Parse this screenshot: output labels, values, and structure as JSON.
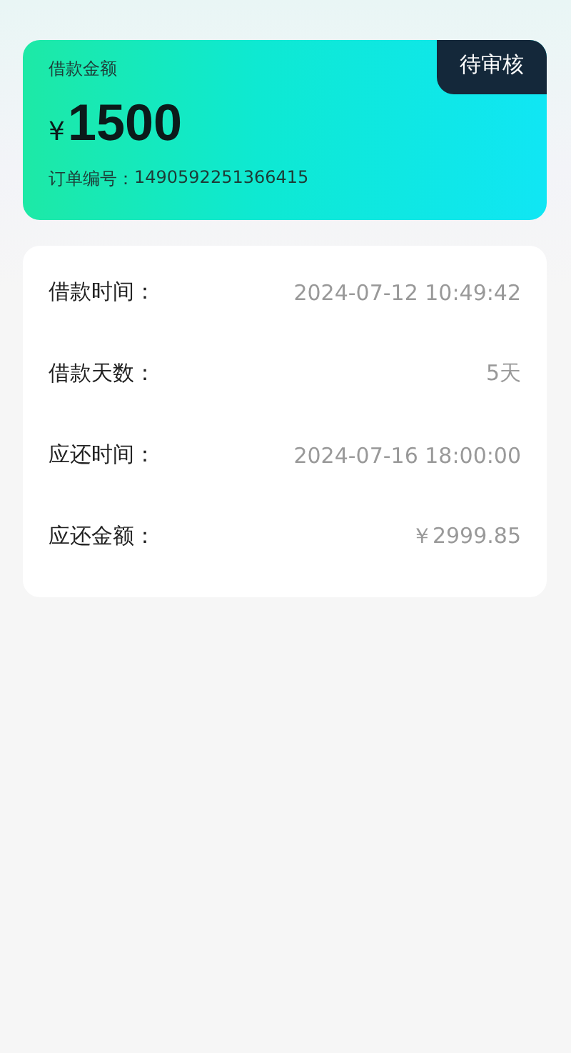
{
  "loan_card": {
    "amount_label": "借款金额",
    "currency": "¥",
    "amount": "1500",
    "order_label": "订单编号：",
    "order_number": "1490592251366415",
    "status": {
      "label": "待审核",
      "kind": "pending"
    }
  },
  "details": [
    {
      "label": "借款时间：",
      "value": "2024-07-12 10:49:42"
    },
    {
      "label": "借款天数：",
      "value": "5天"
    },
    {
      "label": "应还时间：",
      "value": "2024-07-16 18:00:00"
    },
    {
      "label": "应还金额：",
      "value": "￥2999.85"
    }
  ]
}
